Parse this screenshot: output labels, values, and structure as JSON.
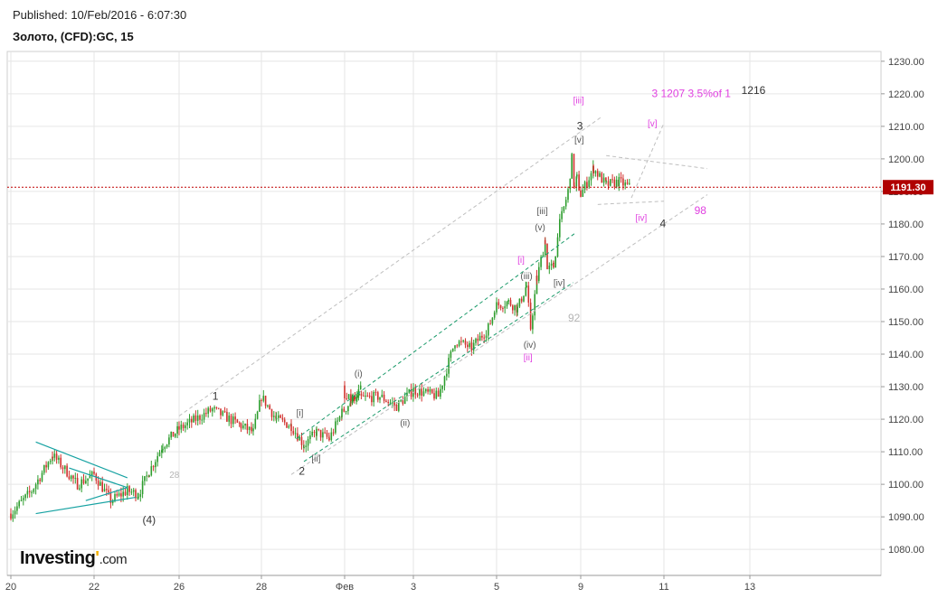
{
  "header": {
    "published": "Published: 10/Feb/2016 - 6:07:30",
    "symbol": "Золото, (CFD):GC, 15"
  },
  "logo": {
    "name": "Investing",
    "mark": "'",
    "domain": ".com"
  },
  "colors": {
    "bull": "#2e9d2e",
    "bear": "#d0312d",
    "channel": "#1a9a6a",
    "triangle": "#17a2a2",
    "price_line": "#c00000",
    "price_tag": "#b00000",
    "magenta": "#e040e0",
    "grid": "#e6e6e6"
  },
  "chart_data": {
    "type": "candlestick",
    "x_ticks": [
      "20",
      "22",
      "26",
      "28",
      "Фев",
      "3",
      "5",
      "9",
      "11",
      "13"
    ],
    "y_ticks": [
      "1080.00",
      "1090.00",
      "1100.00",
      "1110.00",
      "1120.00",
      "1130.00",
      "1140.00",
      "1150.00",
      "1160.00",
      "1170.00",
      "1180.00",
      "1190.00",
      "1200.00",
      "1210.00",
      "1220.00",
      "1230.00"
    ],
    "ylim": [
      1072,
      1233
    ],
    "current_price": {
      "value": 1191.3,
      "label": "1191.30"
    },
    "path": [
      [
        "20",
        1091
      ],
      [
        "20.5",
        1098
      ],
      [
        "21",
        1109
      ],
      [
        "21.6",
        1100
      ],
      [
        "22",
        1103
      ],
      [
        "22.4",
        1095
      ],
      [
        "22.8",
        1098
      ],
      [
        "23.2",
        1097
      ],
      [
        "24",
        1104
      ],
      [
        "25",
        1112
      ],
      [
        "26",
        1117
      ],
      [
        "26.8",
        1123
      ],
      [
        "27.5",
        1118
      ],
      [
        "27.8",
        1116
      ],
      [
        "28",
        1127
      ],
      [
        "28.5",
        1120
      ],
      [
        "29",
        1118
      ],
      [
        "29.5",
        1112
      ],
      [
        "30",
        1116
      ],
      [
        "30.5",
        1114
      ],
      [
        "31",
        1122
      ],
      [
        "31.5",
        1130
      ],
      [
        "Фев",
        1126
      ],
      [
        "2",
        1127
      ],
      [
        "2.5",
        1124
      ],
      [
        "3",
        1129
      ],
      [
        "3.6",
        1127
      ],
      [
        "4",
        1144
      ],
      [
        "4.4",
        1142
      ],
      [
        "4.8",
        1148
      ],
      [
        "5",
        1155
      ],
      [
        "5.4",
        1156
      ],
      [
        "5.7",
        1154
      ],
      [
        "6",
        1161
      ],
      [
        "6.2",
        1148
      ],
      [
        "6.5",
        1163
      ],
      [
        "6.9",
        1175
      ],
      [
        "7",
        1166
      ],
      [
        "7.3",
        1167
      ],
      [
        "7.6",
        1180
      ],
      [
        "8",
        1190
      ],
      [
        "8.3",
        1200
      ],
      [
        "8.5",
        1191
      ],
      [
        "8.7",
        1194
      ],
      [
        "9",
        1189
      ],
      [
        "9.3",
        1197
      ],
      [
        "9.6",
        1192
      ],
      [
        "9.9",
        1193
      ],
      [
        "10.2",
        1191
      ]
    ],
    "annotations": {
      "w1": "1",
      "w2": "2",
      "w3": "3",
      "w4": "4",
      "w4p": "(4)",
      "s_i": "(i)",
      "s_ii": "(ii)",
      "s_iii": "(iii)",
      "s_iv": "(iv)",
      "s_v": "(v)",
      "b_i": "[i]",
      "b_ii": "[ii]",
      "b_iii": "[iii]",
      "b_iv": "[iv]",
      "b_v": "[v]",
      "m_i": "[i]",
      "m_ii": "[ii]",
      "m_iii": "[iii]",
      "m_iv": "[iv]",
      "m_v": "[v]",
      "n28": "28",
      "n92": "92",
      "n98": "98",
      "n1216": "1216",
      "target": "3   1207   3.5%of 1"
    }
  }
}
